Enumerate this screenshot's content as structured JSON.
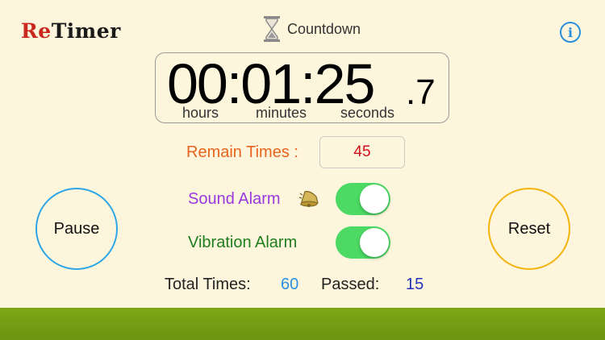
{
  "app": {
    "logo_prefix": "Re",
    "logo_suffix": "Timer"
  },
  "mode": {
    "label": "Countdown",
    "icon": "hourglass-icon"
  },
  "info_button": {
    "label": "i"
  },
  "clock": {
    "time": "00:01:25",
    "tenths": ".7",
    "unit_hours": "hours",
    "unit_minutes": "minutes",
    "unit_seconds": "seconds"
  },
  "remain": {
    "label": "Remain Times :",
    "value": "45"
  },
  "sound_alarm": {
    "label": "Sound Alarm",
    "enabled": true
  },
  "vibration_alarm": {
    "label": "Vibration Alarm",
    "enabled": true
  },
  "buttons": {
    "pause": "Pause",
    "reset": "Reset"
  },
  "totals": {
    "total_label": "Total Times:",
    "total_value": "60",
    "passed_label": "Passed:",
    "passed_value": "15"
  },
  "colors": {
    "background": "#fdf6dc",
    "toggle_on": "#4cd964",
    "pause_ring": "#2ea6e6",
    "reset_ring": "#f2b40c",
    "ground": "#6e9410"
  }
}
